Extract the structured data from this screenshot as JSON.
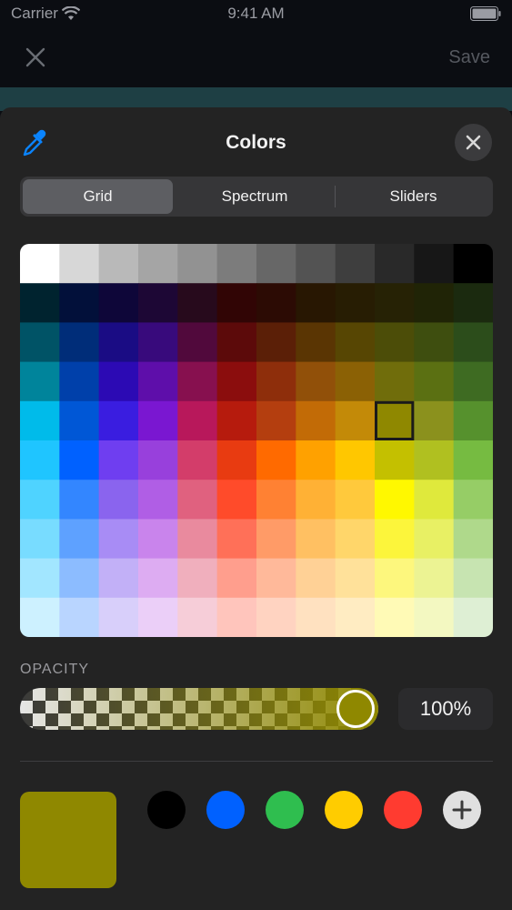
{
  "status_bar": {
    "carrier": "Carrier",
    "time": "9:41 AM"
  },
  "nav": {
    "save_label": "Save",
    "close_icon": "close-icon"
  },
  "sheet": {
    "title": "Colors",
    "segments": [
      "Grid",
      "Spectrum",
      "Sliders"
    ],
    "selected_segment": "Grid"
  },
  "grid": {
    "columns": 12,
    "rows": 10,
    "selected_cell": {
      "row": 4,
      "column": 9
    },
    "colors": [
      [
        "#ffffff",
        "#d7d7d7",
        "#b9b9b9",
        "#a5a5a5",
        "#929292",
        "#7c7c7c",
        "#676767",
        "#535353",
        "#3e3e3e",
        "#292929",
        "#171717",
        "#000000"
      ],
      [
        "#00232f",
        "#02103a",
        "#0e0639",
        "#1d0735",
        "#270a1c",
        "#310505",
        "#2c0b04",
        "#281702",
        "#271d03",
        "#262205",
        "#202406",
        "#1b2a0f"
      ],
      [
        "#005366",
        "#002d79",
        "#1a0c84",
        "#380a7c",
        "#51093c",
        "#5c0a0a",
        "#5b1f07",
        "#5a3503",
        "#574603",
        "#4c4d08",
        "#3e4e0f",
        "#2c4d1b"
      ],
      [
        "#00849b",
        "#0040aa",
        "#2c0ab4",
        "#5e0eaa",
        "#87104f",
        "#8b0d0d",
        "#8e2e0b",
        "#915009",
        "#8b6105",
        "#706d0b",
        "#5b7012",
        "#3e6b22"
      ],
      [
        "#00bbea",
        "#0057d6",
        "#3a1de0",
        "#7a17d1",
        "#b8185b",
        "#b61b0d",
        "#b43e0f",
        "#c26b06",
        "#c38a08",
        "#8f8800",
        "#8b911d",
        "#56912d"
      ],
      [
        "#1fc5ff",
        "#0061ff",
        "#6f3ef0",
        "#9840dc",
        "#d33d6a",
        "#e83b11",
        "#ff6a00",
        "#ffa100",
        "#ffc700",
        "#c4c000",
        "#b0c020",
        "#76bb41"
      ],
      [
        "#4fd3ff",
        "#3386ff",
        "#8a64ee",
        "#b05ee5",
        "#e0617f",
        "#ff4b2a",
        "#ff8133",
        "#ffb135",
        "#ffc93c",
        "#fff800",
        "#dfe93c",
        "#96cd66"
      ],
      [
        "#78dcff",
        "#5ea1ff",
        "#a88cf5",
        "#c984ec",
        "#e98a9e",
        "#ff7058",
        "#ff9b67",
        "#ffc062",
        "#ffd66a",
        "#fcf53b",
        "#e8f064",
        "#afd98b"
      ],
      [
        "#a2e6ff",
        "#8cbcff",
        "#c2b0f7",
        "#ddacf2",
        "#f0afbd",
        "#ff9e8d",
        "#ffb99a",
        "#ffd196",
        "#ffe19a",
        "#fdf77d",
        "#ecf393",
        "#c7e4b1"
      ],
      [
        "#cdf1ff",
        "#b9d5ff",
        "#d8cffa",
        "#ebcff8",
        "#f6cdd8",
        "#ffc5bc",
        "#ffd3c1",
        "#ffe1c0",
        "#ffecc2",
        "#fffab6",
        "#f3f8c1",
        "#deefd4"
      ]
    ]
  },
  "opacity": {
    "label": "OPACITY",
    "value_text": "100%",
    "value": 1.0
  },
  "current_color": "#8f8800",
  "favorites": [
    "#000000",
    "#0061ff",
    "#2fbe4f",
    "#ffcc00",
    "#ff3b30"
  ],
  "colors": {
    "accent_blue": "#0a84ff",
    "sheet_bg": "#232323"
  }
}
